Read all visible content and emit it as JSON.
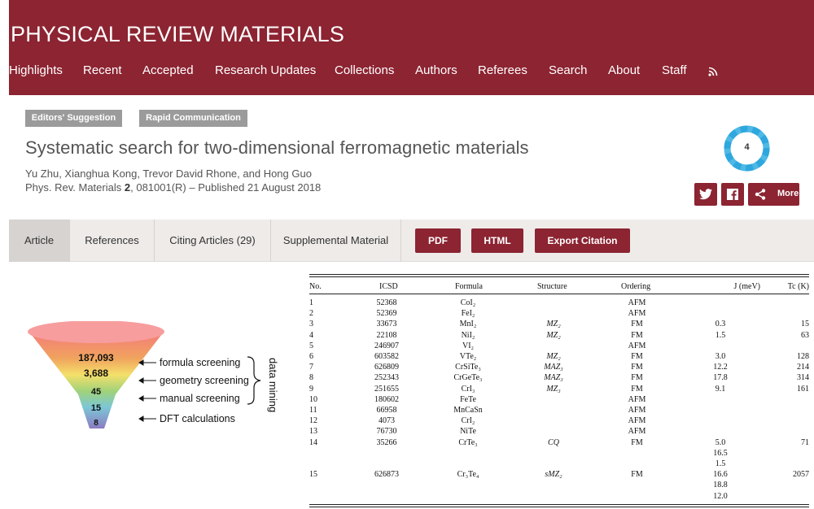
{
  "header": {
    "journal_title": "PHYSICAL REVIEW MATERIALS",
    "nav": [
      "Highlights",
      "Recent",
      "Accepted",
      "Research Updates",
      "Collections",
      "Authors",
      "Referees",
      "Search",
      "About",
      "Staff"
    ],
    "rss_icon": "rss-icon"
  },
  "badges": [
    "Editors' Suggestion",
    "Rapid Communication"
  ],
  "article": {
    "title": "Systematic search for two-dimensional ferromagnetic materials",
    "authors": "Yu Zhu, Xianghua Kong, Trevor David Rhone, and Hong Guo",
    "journal": "Phys. Rev. Materials",
    "volume": "2",
    "citation_rest": ", 081001(R) – Published 21 August 2018"
  },
  "altmetric_score": "4",
  "share": {
    "twitter_icon": "twitter-icon",
    "facebook_icon": "facebook-icon",
    "more_label": "More"
  },
  "tabs": [
    "Article",
    "References",
    "Citing Articles (29)",
    "Supplemental Material"
  ],
  "action_buttons": [
    "PDF",
    "HTML",
    "Export Citation"
  ],
  "colors": {
    "brand": "#8c2432",
    "badge": "#9b9b9b",
    "tabbar": "#eeebe9"
  },
  "funnel": {
    "counts": [
      "187,093",
      "3,688",
      "45",
      "15",
      "8"
    ],
    "steps": [
      "formula screening",
      "geometry screening",
      "manual screening",
      "DFT calculations"
    ],
    "side_label": "data mining"
  },
  "table": {
    "headers": [
      "No.",
      "ICSD",
      "Formula",
      "Structure",
      "Ordering",
      "J (meV)",
      "Tc (K)"
    ],
    "rows": [
      [
        "1",
        "52368",
        "CoI₂",
        "",
        "AFM",
        "",
        ""
      ],
      [
        "2",
        "52369",
        "FeI₂",
        "",
        "AFM",
        "",
        ""
      ],
      [
        "3",
        "33673",
        "MnI₂",
        "MZ₂",
        "FM",
        "0.3",
        "15"
      ],
      [
        "4",
        "22108",
        "NiI₂",
        "MZ₂",
        "FM",
        "1.5",
        "63"
      ],
      [
        "5",
        "246907",
        "VI₂",
        "",
        "AFM",
        "",
        ""
      ],
      [
        "6",
        "603582",
        "VTe₂",
        "MZ₂",
        "FM",
        "3.0",
        "128"
      ],
      [
        "7",
        "626809",
        "CrSiTe₃",
        "MAZ₃",
        "FM",
        "12.2",
        "214"
      ],
      [
        "8",
        "252343",
        "CrGeTe₃",
        "MAZ₃",
        "FM",
        "17.8",
        "314"
      ],
      [
        "9",
        "251655",
        "CrI₃",
        "MZ₃",
        "FM",
        "9.1",
        "161"
      ],
      [
        "10",
        "180602",
        "FeTe",
        "",
        "AFM",
        "",
        ""
      ],
      [
        "11",
        "66958",
        "MnCaSn",
        "",
        "AFM",
        "",
        ""
      ],
      [
        "12",
        "4073",
        "CrI₂",
        "",
        "AFM",
        "",
        ""
      ],
      [
        "13",
        "76730",
        "NiTe",
        "",
        "AFM",
        "",
        ""
      ],
      [
        "14",
        "35266",
        "CrTe₃",
        "CQ",
        "FM",
        "5.0",
        "71"
      ],
      [
        "",
        "",
        "",
        "",
        "",
        "16.5",
        ""
      ],
      [
        "",
        "",
        "",
        "",
        "",
        "1.5",
        ""
      ],
      [
        "15",
        "626873",
        "Cr₃Te₄",
        "sMZ₂",
        "FM",
        "16.6",
        "2057"
      ],
      [
        "",
        "",
        "",
        "",
        "",
        "18.8",
        ""
      ],
      [
        "",
        "",
        "",
        "",
        "",
        "12.0",
        ""
      ]
    ]
  }
}
